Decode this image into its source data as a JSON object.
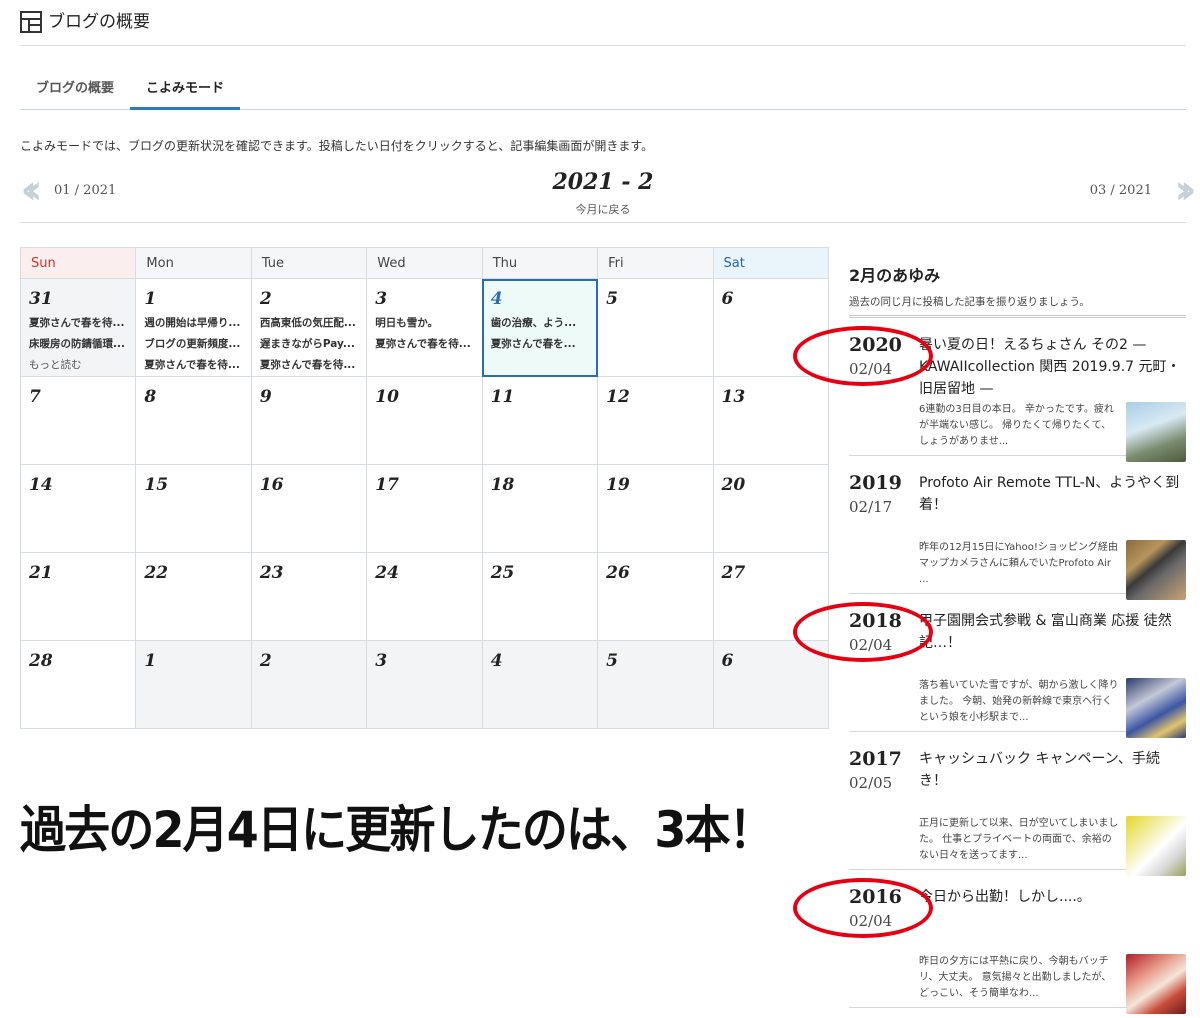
{
  "header": {
    "icon": "layout-icon",
    "title": "ブログの概要"
  },
  "tabs": [
    {
      "label": "ブログの概要",
      "active": false
    },
    {
      "label": "こよみモード",
      "active": true
    }
  ],
  "description": "こよみモードでは、ブログの更新状況を確認できます。投稿したい日付をクリックすると、記事編集画面が開きます。",
  "nav": {
    "prev_label": "01 / 2021",
    "next_label": "03 / 2021",
    "current": "2021 - 2",
    "back_to_today": "今月に戻る"
  },
  "calendar": {
    "weekdays": [
      "Sun",
      "Mon",
      "Tue",
      "Wed",
      "Thu",
      "Fri",
      "Sat"
    ],
    "weeks": [
      [
        {
          "day": "31",
          "other": true,
          "posts": [
            "夏弥さんで春を待...",
            "床暖房の防錆循環..."
          ],
          "more": "もっと読む"
        },
        {
          "day": "1",
          "posts": [
            "週の開始は早帰り...",
            "ブログの更新頻度...",
            "夏弥さんで春を待..."
          ]
        },
        {
          "day": "2",
          "posts": [
            "西高東低の気圧配...",
            "遅まきながらPay...",
            "夏弥さんで春を待..."
          ]
        },
        {
          "day": "3",
          "posts": [
            "明日も雪か。",
            "夏弥さんで春を待..."
          ]
        },
        {
          "day": "4",
          "today": true,
          "posts": [
            "歯の治療、よう...",
            "夏弥さんで春を..."
          ]
        },
        {
          "day": "5",
          "posts": []
        },
        {
          "day": "6",
          "posts": []
        }
      ],
      [
        {
          "day": "7",
          "posts": []
        },
        {
          "day": "8",
          "posts": []
        },
        {
          "day": "9",
          "posts": []
        },
        {
          "day": "10",
          "posts": []
        },
        {
          "day": "11",
          "posts": []
        },
        {
          "day": "12",
          "posts": []
        },
        {
          "day": "13",
          "posts": []
        }
      ],
      [
        {
          "day": "14",
          "posts": []
        },
        {
          "day": "15",
          "posts": []
        },
        {
          "day": "16",
          "posts": []
        },
        {
          "day": "17",
          "posts": []
        },
        {
          "day": "18",
          "posts": []
        },
        {
          "day": "19",
          "posts": []
        },
        {
          "day": "20",
          "posts": []
        }
      ],
      [
        {
          "day": "21",
          "posts": []
        },
        {
          "day": "22",
          "posts": []
        },
        {
          "day": "23",
          "posts": []
        },
        {
          "day": "24",
          "posts": []
        },
        {
          "day": "25",
          "posts": []
        },
        {
          "day": "26",
          "posts": []
        },
        {
          "day": "27",
          "posts": []
        }
      ],
      [
        {
          "day": "28",
          "posts": []
        },
        {
          "day": "1",
          "other": true,
          "posts": []
        },
        {
          "day": "2",
          "other": true,
          "posts": []
        },
        {
          "day": "3",
          "other": true,
          "posts": []
        },
        {
          "day": "4",
          "other": true,
          "posts": []
        },
        {
          "day": "5",
          "other": true,
          "posts": []
        },
        {
          "day": "6",
          "other": true,
          "posts": []
        }
      ]
    ]
  },
  "caption": "過去の2月4日に更新したのは、3本！",
  "sidebar": {
    "title": "2月のあゆみ",
    "subtitle": "過去の同じ月に投稿した記事を振り返りましょう。",
    "entries": [
      {
        "year": "2020",
        "date": "02/04",
        "title": "暑い夏の日！えるちょさん その2 — KAWAIIcollection 関西 2019.9.7 元町・旧居留地 —",
        "excerpt": "6連勤の3日目の本日。 辛かったです。疲れが半端ない感じ。 帰りたくて帰りたくて、しょうがありませ...",
        "circled": true
      },
      {
        "year": "2019",
        "date": "02/17",
        "title": "Profoto Air Remote TTL-N、ようやく到着！",
        "excerpt": "昨年の12月15日にYahoo!ショッピング経由マップカメラさんに頼んでいたProfoto Air ...",
        "circled": false
      },
      {
        "year": "2018",
        "date": "02/04",
        "title": "甲子園開会式参戦 & 富山商業 応援 徒然記…！",
        "excerpt": "落ち着いていた雪ですが、朝から激しく降りました。 今朝、始発の新幹線で東京へ行くという娘を小杉駅まで...",
        "circled": true
      },
      {
        "year": "2017",
        "date": "02/05",
        "title": "キャッシュバック キャンペーン、手続き！",
        "excerpt": "正月に更新して以来、日が空いてしまいました。 仕事とプライベートの両面で、余裕のない日々を送ってます...",
        "circled": false
      },
      {
        "year": "2016",
        "date": "02/04",
        "title": "今日から出勤！しかし....。",
        "excerpt": "昨日の夕方には平熱に戻り、今朝もバッチリ、大丈夫。 意気揚々と出勤しましたが、どっこい、そう簡単なわ...",
        "circled": true
      }
    ]
  },
  "colors": {
    "accent": "#2b7bbe",
    "annotation": "#e60012",
    "sunday": "#d0342c",
    "saturday": "#1f63b4"
  }
}
